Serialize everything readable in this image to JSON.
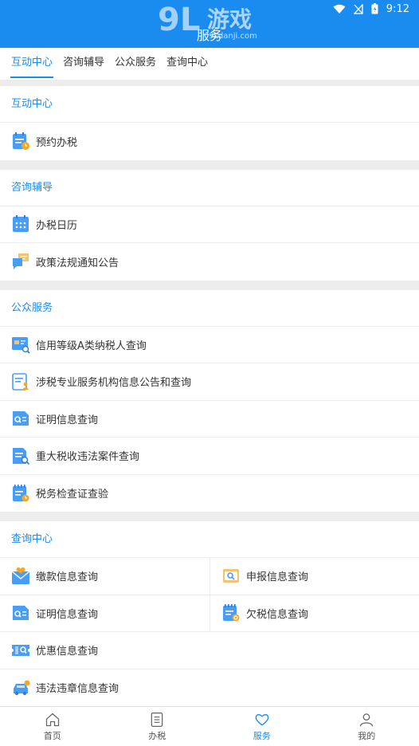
{
  "status_bar": {
    "time": "9:12"
  },
  "header": {
    "title": "服务",
    "watermark_main": "9L游戏",
    "watermark_sub": "9Ldanji.com"
  },
  "tabs": [
    {
      "label": "互动中心"
    },
    {
      "label": "咨询辅导"
    },
    {
      "label": "公众服务"
    },
    {
      "label": "查询中心"
    }
  ],
  "sections": {
    "interactive": {
      "title": "互动中心",
      "items": [
        {
          "label": "预约办税"
        }
      ]
    },
    "consult": {
      "title": "咨询辅导",
      "items": [
        {
          "label": "办税日历"
        },
        {
          "label": "政策法规通知公告"
        }
      ]
    },
    "public": {
      "title": "公众服务",
      "items": [
        {
          "label": "信用等级A类纳税人查询"
        },
        {
          "label": "涉税专业服务机构信息公告和查询"
        },
        {
          "label": "证明信息查询"
        },
        {
          "label": "重大税收违法案件查询"
        },
        {
          "label": "税务检查证查验"
        }
      ]
    },
    "query": {
      "title": "查询中心",
      "items": [
        {
          "label": "缴款信息查询"
        },
        {
          "label": "申报信息查询"
        },
        {
          "label": "证明信息查询"
        },
        {
          "label": "欠税信息查询"
        },
        {
          "label": "优惠信息查询"
        },
        {
          "label": "违法违章信息查询"
        }
      ]
    }
  },
  "bottom_nav": [
    {
      "label": "首页",
      "icon": "home-icon"
    },
    {
      "label": "办税",
      "icon": "list-icon"
    },
    {
      "label": "服务",
      "icon": "heart-icon"
    },
    {
      "label": "我的",
      "icon": "user-icon"
    }
  ],
  "colors": {
    "accent": "#1a8cf0",
    "icon_blue": "#4a9df5",
    "icon_orange": "#f5a623"
  }
}
